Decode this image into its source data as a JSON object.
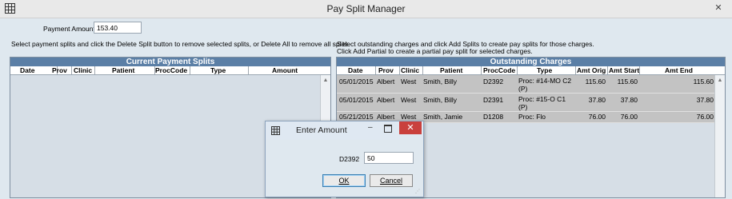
{
  "window": {
    "title": "Pay Split Manager",
    "close_glyph": "✕",
    "icon": "grid-icon"
  },
  "payment": {
    "label": "Payment Amount",
    "value": "153.40"
  },
  "instructions": {
    "left": "Select payment splits and click the Delete Split button to remove selected splits, or Delete All to remove all splits.",
    "right_line1": "Select outstanding charges and click Add Splits to create pay splits for those charges.",
    "right_line2": "Click Add Partial to create a partial pay split for selected charges."
  },
  "splits_grid": {
    "title": "Current Payment Splits",
    "columns": [
      "Date",
      "Prov",
      "Clinic",
      "Patient",
      "ProcCode",
      "Type",
      "Amount"
    ],
    "rows": []
  },
  "charges_grid": {
    "title": "Outstanding Charges",
    "columns": [
      "Date",
      "Prov",
      "Clinic",
      "Patient",
      "ProcCode",
      "Type",
      "Amt Orig",
      "Amt Start",
      "Amt End"
    ],
    "rows": [
      {
        "date": "05/01/2015",
        "prov": "Albert",
        "clinic": "West",
        "patient": "Smith, Billy",
        "proccode": "D2392",
        "type": "Proc: #14-MO C2 (P)",
        "amt_orig": "115.60",
        "amt_start": "115.60",
        "amt_end": "115.60"
      },
      {
        "date": "05/01/2015",
        "prov": "Albert",
        "clinic": "West",
        "patient": "Smith, Billy",
        "proccode": "D2391",
        "type": "Proc: #15-O C1 (P)",
        "amt_orig": "37.80",
        "amt_start": "37.80",
        "amt_end": "37.80"
      },
      {
        "date": "05/21/2015",
        "prov": "Albert",
        "clinic": "West",
        "patient": "Smith, Jamie",
        "proccode": "D1208",
        "type": "Proc:  Flo",
        "amt_orig": "76.00",
        "amt_start": "76.00",
        "amt_end": "76.00"
      }
    ]
  },
  "dialog": {
    "title": "Enter Amount",
    "min_glyph": "–",
    "close_glyph": "✕",
    "field_label": "D2392",
    "field_value": "50",
    "ok_label": "OK",
    "cancel_label": "Cancel"
  }
}
